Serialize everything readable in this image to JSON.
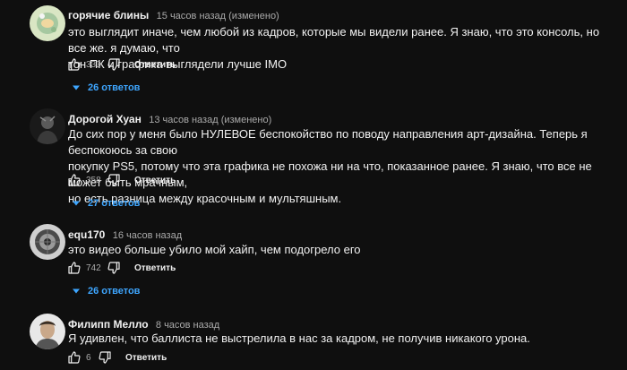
{
  "comments": [
    {
      "author": "горячие блины",
      "time": "15 часов назад (изменено)",
      "text": "это выглядит иначе, чем любой из кадров, которые мы видели ранее. Я знаю, что это консоль, но все же. я думаю, что\nтон ПК и графика выглядели лучше IMO",
      "likes": "333",
      "reply_label": "Ответить",
      "replies_label": "26 ответов"
    },
    {
      "author": "Дорогой Хуан",
      "time": "13 часов назад (изменено)",
      "text": "До сих пор у меня было НУЛЕВОЕ беспокойство по поводу направления арт-дизайна. Теперь я беспокоюсь за свою\nпокупку PS5, потому что эта графика не похожа ни на что, показанное ранее. Я знаю, что все не может быть мрачным,\nно есть разница между красочным и мультяшным.",
      "likes": "358",
      "reply_label": "Ответить",
      "replies_label": "27 ответов"
    },
    {
      "author": "equ170",
      "time": "16 часов назад",
      "text": "это видео больше убило мой хайп, чем подогрело его",
      "likes": "742",
      "reply_label": "Ответить",
      "replies_label": "26 ответов"
    },
    {
      "author": "Филипп Мелло",
      "time": "8 часов назад",
      "text": "Я удивлен, что баллиста не выстрелила в нас за кадром, не получив никакого урона.",
      "likes": "6",
      "reply_label": "Ответить"
    }
  ],
  "colors": {
    "background": "#0f0f0f",
    "link": "#3ea6ff",
    "secondary_text": "#aaaaaa"
  },
  "icons": [
    "thumbs-up-icon",
    "thumbs-down-icon",
    "chevron-down-icon"
  ]
}
